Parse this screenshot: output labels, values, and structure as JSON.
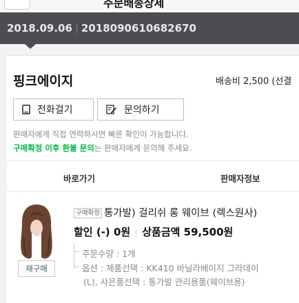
{
  "header": {
    "back_label": "",
    "title": "주문배송상세"
  },
  "order": {
    "date": "2018.09.06",
    "number": "2018090610682670"
  },
  "seller": {
    "name": "핑크에이지",
    "shipping": "배송비 2,500 (선결"
  },
  "actions": {
    "call_label": "전화걸기",
    "ask_label": "문의하기"
  },
  "notice": {
    "line1": "판매자에게 직접 연락하시면 빠른 확인이 가능합니다.",
    "line2_highlight": "구매확정 이후 환불 문의",
    "line2_rest": "는 판매자에게 문의해 주세요."
  },
  "links": {
    "go_label": "바로가기",
    "seller_info_label": "판매자정보"
  },
  "product": {
    "badge": "구매확정",
    "title": "통가발) 걸리쉬 롱 웨이브 (렉스원사)",
    "discount": "할인 (-) 0원",
    "amount": "상품금액 59,500원",
    "quantity": "주문수량 : 1개",
    "option_line1": "옵션 : 제품선택 : KK410 바닐라베이지 그라데이",
    "option_line2": "(L), 사은품선택 : 통가발 관리용품(웨이브용)",
    "rebuy_label": "재구매"
  },
  "colors": {
    "order_bar": "#4b4d52",
    "highlight_green": "#00b843"
  }
}
